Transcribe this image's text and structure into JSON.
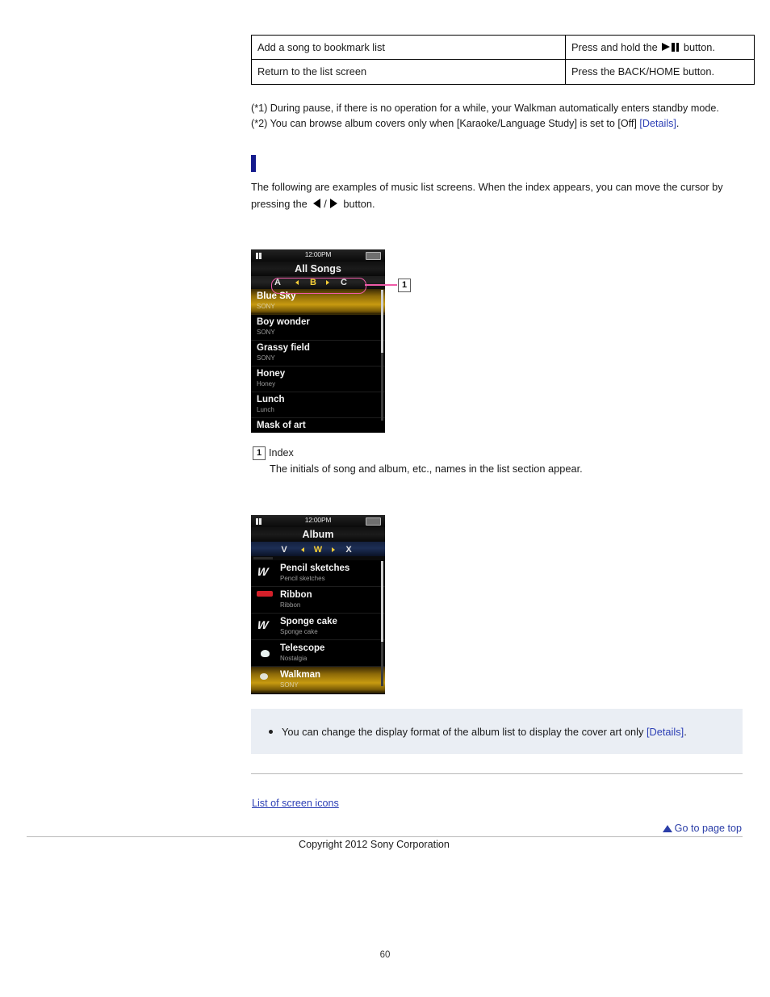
{
  "table": {
    "rows": [
      {
        "action": "Add a song to bookmark list",
        "howto_before": "Press and hold the",
        "howto_icon": "play-pause-icon",
        "howto_after": "button."
      },
      {
        "action": "Return to the list screen",
        "howto_before": "Press the BACK/HOME button.",
        "howto_icon": "",
        "howto_after": ""
      }
    ]
  },
  "footnotes": {
    "note1": "(*1) During pause, if there is no operation for a while, your Walkman automatically enters standby mode.",
    "note2_before": "(*2) You can browse album covers only when [Karaoke/Language Study] is set to [Off]",
    "note2_link": "[Details]",
    "note2_after": "."
  },
  "section": {
    "heading": ""
  },
  "intro": {
    "text_before": "The following are examples of music list screens. When the index appears, you can move the cursor by pressing the",
    "separator": "/",
    "text_after": "button.",
    "left_icon": "left-arrow-icon",
    "right_icon": "right-arrow-icon"
  },
  "screen1": {
    "status": {
      "pause_icon": "pause-icon",
      "clock": "12:00PM",
      "battery_icon": "battery-icon"
    },
    "title": "All Songs",
    "index": {
      "prev": "A",
      "current": "B",
      "next": "C",
      "left_tick": "left-triangle-icon",
      "right_tick": "right-triangle-icon"
    },
    "rows": [
      {
        "title": "Blue Sky",
        "subtitle": "SONY",
        "selected": true
      },
      {
        "title": "Boy wonder",
        "subtitle": "SONY",
        "selected": false
      },
      {
        "title": "Grassy field",
        "subtitle": "SONY",
        "selected": false
      },
      {
        "title": "Honey",
        "subtitle": "Honey",
        "selected": false
      },
      {
        "title": "Lunch",
        "subtitle": "Lunch",
        "selected": false
      },
      {
        "title": "Mask of art",
        "subtitle": "",
        "selected": false
      }
    ]
  },
  "callout": {
    "number": "1"
  },
  "legend": {
    "number": "1",
    "label": "Index",
    "description": "The initials of song and album, etc., names in the list section appear."
  },
  "screen2": {
    "status": {
      "pause_icon": "pause-icon",
      "clock": "12:00PM",
      "battery_icon": "battery-icon"
    },
    "title": "Album",
    "index": {
      "prev": "V",
      "current": "W",
      "next": "X",
      "left_tick": "left-triangle-icon",
      "right_tick": "right-triangle-icon"
    },
    "rows": [
      {
        "title": "Pencil sketches",
        "subtitle": "Pencil sketches",
        "art": "walkman-logo-thumbnail",
        "selected": false
      },
      {
        "title": "Ribbon",
        "subtitle": "Ribbon",
        "art": "red-car-thumbnail",
        "selected": false
      },
      {
        "title": "Sponge cake",
        "subtitle": "Sponge cake",
        "art": "walkman-logo-thumbnail",
        "selected": false
      },
      {
        "title": "Telescope",
        "subtitle": "Nostalgia",
        "art": "bird-photo-thumbnail",
        "selected": false
      },
      {
        "title": "Walkman",
        "subtitle": "SONY",
        "art": "sky-photo-thumbnail",
        "selected": true
      }
    ]
  },
  "tip": {
    "text_before": "You can change the display format of the album list to display the cover art only",
    "link": "[Details]",
    "text_after": "."
  },
  "footer": {
    "screen_icons_link": "List of screen icons",
    "go_to_top": "Go to page top",
    "copyright": "Copyright 2012 Sony Corporation",
    "page_number": "60"
  },
  "colors": {
    "link": "#2c3fb5",
    "section_bar": "#151b8d",
    "callout": "#ef5ba8",
    "index_highlight": "#f7cf38",
    "tip_background": "#eaeef4"
  }
}
